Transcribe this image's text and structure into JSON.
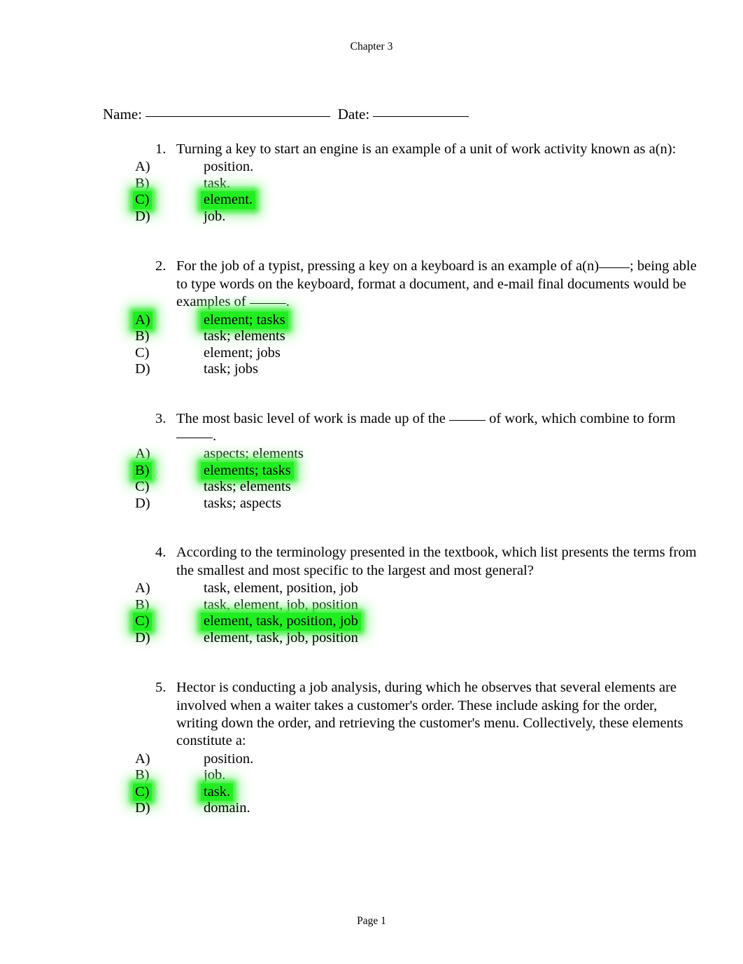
{
  "document": {
    "header_title": "Chapter 3",
    "footer_text": "Page 1",
    "name_label": "Name:",
    "date_label": "Date:"
  },
  "highlight_color": "#21ee21",
  "questions": [
    {
      "number": "1.",
      "text": "Turning a key to start an engine is an example of a unit of work activity known as a(n):",
      "options": [
        {
          "letter": "A)",
          "text": "position.",
          "highlighted": false
        },
        {
          "letter": "B)",
          "text": "task.",
          "highlighted": false
        },
        {
          "letter": "C)",
          "text": "element.",
          "highlighted": true
        },
        {
          "letter": "D)",
          "text": "job.",
          "highlighted": false
        }
      ]
    },
    {
      "number": "2.",
      "text_part1": "For the job of a typist, pressing a key on a keyboard is an example of a(n)",
      "text_part2": "; being able to type words on the keyboard, format a document, and e-mail final documents would be examples of ",
      "text_part3": ".",
      "options": [
        {
          "letter": "A)",
          "text": "element; tasks",
          "highlighted": true
        },
        {
          "letter": "B)",
          "text": "task; elements",
          "highlighted": false
        },
        {
          "letter": "C)",
          "text": "element; jobs",
          "highlighted": false
        },
        {
          "letter": "D)",
          "text": "task; jobs",
          "highlighted": false
        }
      ]
    },
    {
      "number": "3.",
      "text_part1": "The most basic level of work is made up of the ",
      "text_part2": " of work, which combine to form ",
      "text_part3": ".",
      "options": [
        {
          "letter": "A)",
          "text": "aspects; elements",
          "highlighted": false
        },
        {
          "letter": "B)",
          "text": "elements; tasks",
          "highlighted": true
        },
        {
          "letter": "C)",
          "text": "tasks; elements",
          "highlighted": false
        },
        {
          "letter": "D)",
          "text": "tasks; aspects",
          "highlighted": false
        }
      ]
    },
    {
      "number": "4.",
      "text": "According to the terminology presented in the textbook, which list presents the terms from the smallest and most specific to the largest and most general?",
      "options": [
        {
          "letter": "A)",
          "text": "task, element, position, job",
          "highlighted": false
        },
        {
          "letter": "B)",
          "text": "task, element, job, position",
          "highlighted": false
        },
        {
          "letter": "C)",
          "text": "element, task, position, job",
          "highlighted": true
        },
        {
          "letter": "D)",
          "text": "element, task, job, position",
          "highlighted": false
        }
      ]
    },
    {
      "number": "5.",
      "text": "Hector is conducting a job analysis, during which he observes that several elements are involved when a waiter takes a customer's order. These include asking for the order, writing down the order, and retrieving the customer's menu. Collectively, these elements constitute a:",
      "options": [
        {
          "letter": "A)",
          "text": "position.",
          "highlighted": false
        },
        {
          "letter": "B)",
          "text": "job.",
          "highlighted": false
        },
        {
          "letter": "C)",
          "text": "task.",
          "highlighted": true
        },
        {
          "letter": "D)",
          "text": "domain.",
          "highlighted": false
        }
      ]
    }
  ]
}
